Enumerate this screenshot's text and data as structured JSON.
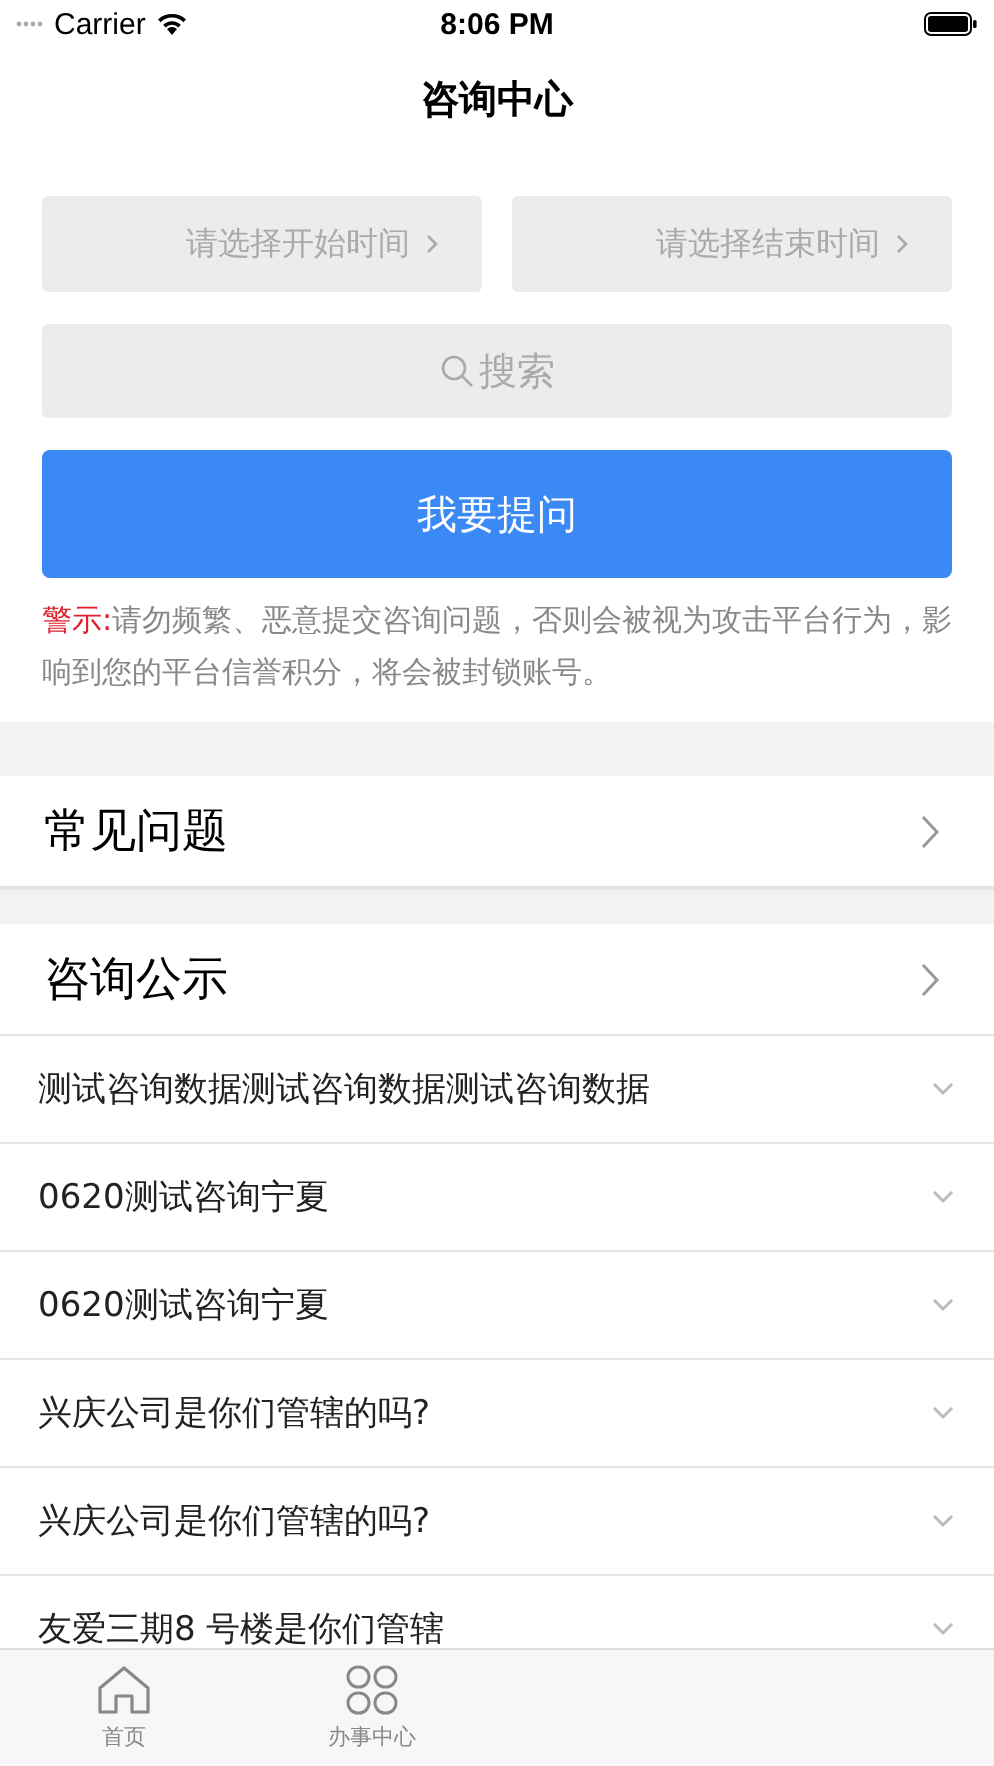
{
  "status_bar": {
    "carrier": "Carrier",
    "time": "8:06 PM"
  },
  "title": "咨询中心",
  "date_fields": [
    {
      "placeholder": "请选择开始时间"
    },
    {
      "placeholder": "请选择结束时间"
    }
  ],
  "search_button": "搜索",
  "ask_button": "我要提问",
  "warning": {
    "label": "警示:",
    "text": "请勿频繁、恶意提交咨询问题，否则会被视为攻击平台行为，影响到您的平台信誉积分，将会被封锁账号。"
  },
  "sections": [
    {
      "title": "常见问题"
    },
    {
      "title": "咨询公示"
    }
  ],
  "questions": [
    "测试咨询数据测试咨询数据测试咨询数据",
    "0620测试咨询宁夏",
    "0620测试咨询宁夏",
    "兴庆公司是你们管辖的吗?",
    "兴庆公司是你们管辖的吗?",
    "友爱三期8 号楼是你们管辖"
  ],
  "tabs": [
    {
      "label": "首页",
      "kind": "home"
    },
    {
      "label": "办事中心",
      "kind": "grid"
    }
  ]
}
